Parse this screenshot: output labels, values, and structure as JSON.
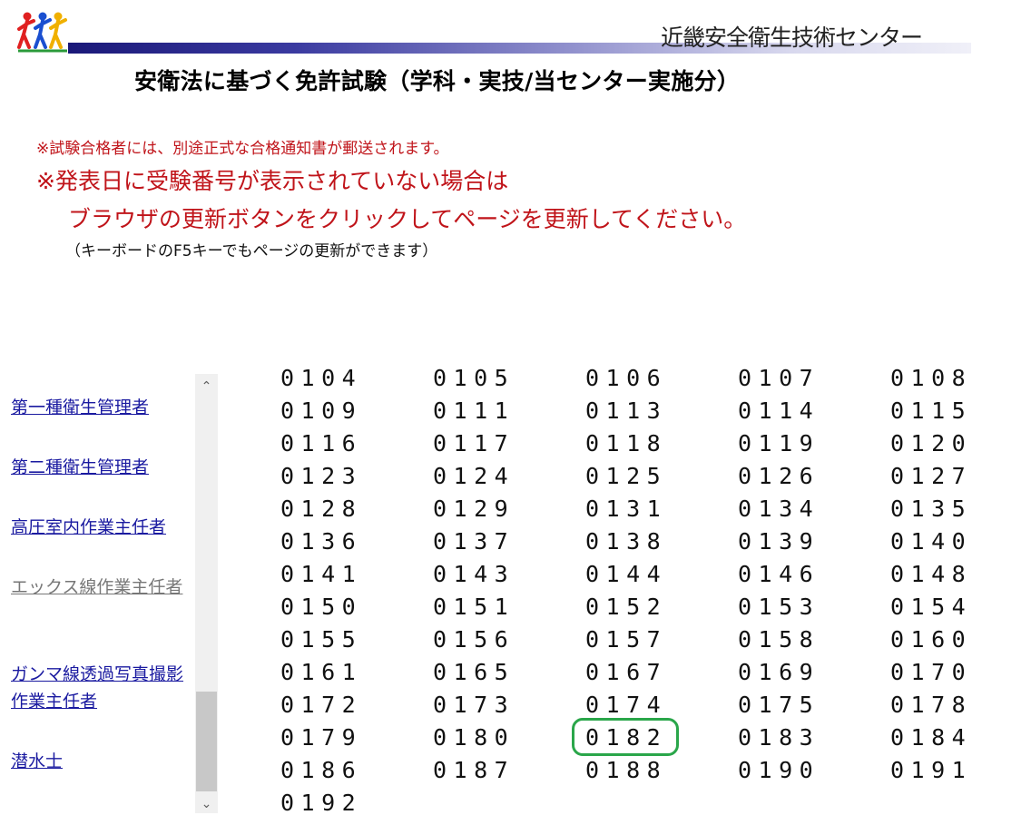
{
  "header": {
    "org_name": "近畿安全衛生技術センター",
    "logo_icon": "runners-logo-icon",
    "colors": {
      "bar_dark": "#1a1878",
      "bar_light": "#f0f0f8"
    }
  },
  "page_title": "安衛法に基づく免許試験（学科・実技/当センター実施分）",
  "notices": {
    "small": "※試験合格者には、別途正式な合格通知書が郵送されます。",
    "large_line1": "※発表日に受験番号が表示されていない場合は",
    "large_line2": "ブラウザの更新ボタンをクリックしてページを更新してください。",
    "f5": "（キーボードのF5キーでもページの更新ができます）",
    "color": "#c0141a"
  },
  "sidebar": {
    "items": [
      {
        "label": "第一種衛生管理者",
        "visited": false
      },
      {
        "label": "第二種衛生管理者",
        "visited": false
      },
      {
        "label": "高圧室内作業主任者",
        "visited": false
      },
      {
        "label": "エックス線作業主任者",
        "visited": true
      },
      {
        "label": "ガンマ線透過写真撮影作業主任者",
        "visited": false
      },
      {
        "label": "潜水士",
        "visited": false
      }
    ]
  },
  "scrollbar": {
    "up_icon": "chevron-up-icon",
    "down_icon": "chevron-down-icon"
  },
  "pass_numbers": {
    "columns": 5,
    "highlighted": "0182",
    "highlight_color": "#2aa64a",
    "rows": [
      [
        "0104",
        "0105",
        "0106",
        "0107",
        "0108"
      ],
      [
        "0109",
        "0111",
        "0113",
        "0114",
        "0115"
      ],
      [
        "0116",
        "0117",
        "0118",
        "0119",
        "0120"
      ],
      [
        "0123",
        "0124",
        "0125",
        "0126",
        "0127"
      ],
      [
        "0128",
        "0129",
        "0131",
        "0134",
        "0135"
      ],
      [
        "0136",
        "0137",
        "0138",
        "0139",
        "0140"
      ],
      [
        "0141",
        "0143",
        "0144",
        "0146",
        "0148"
      ],
      [
        "0150",
        "0151",
        "0152",
        "0153",
        "0154"
      ],
      [
        "0155",
        "0156",
        "0157",
        "0158",
        "0160"
      ],
      [
        "0161",
        "0165",
        "0167",
        "0169",
        "0170"
      ],
      [
        "0172",
        "0173",
        "0174",
        "0175",
        "0178"
      ],
      [
        "0179",
        "0180",
        "0182",
        "0183",
        "0184"
      ],
      [
        "0186",
        "0187",
        "0188",
        "0190",
        "0191"
      ],
      [
        "0192"
      ]
    ]
  }
}
